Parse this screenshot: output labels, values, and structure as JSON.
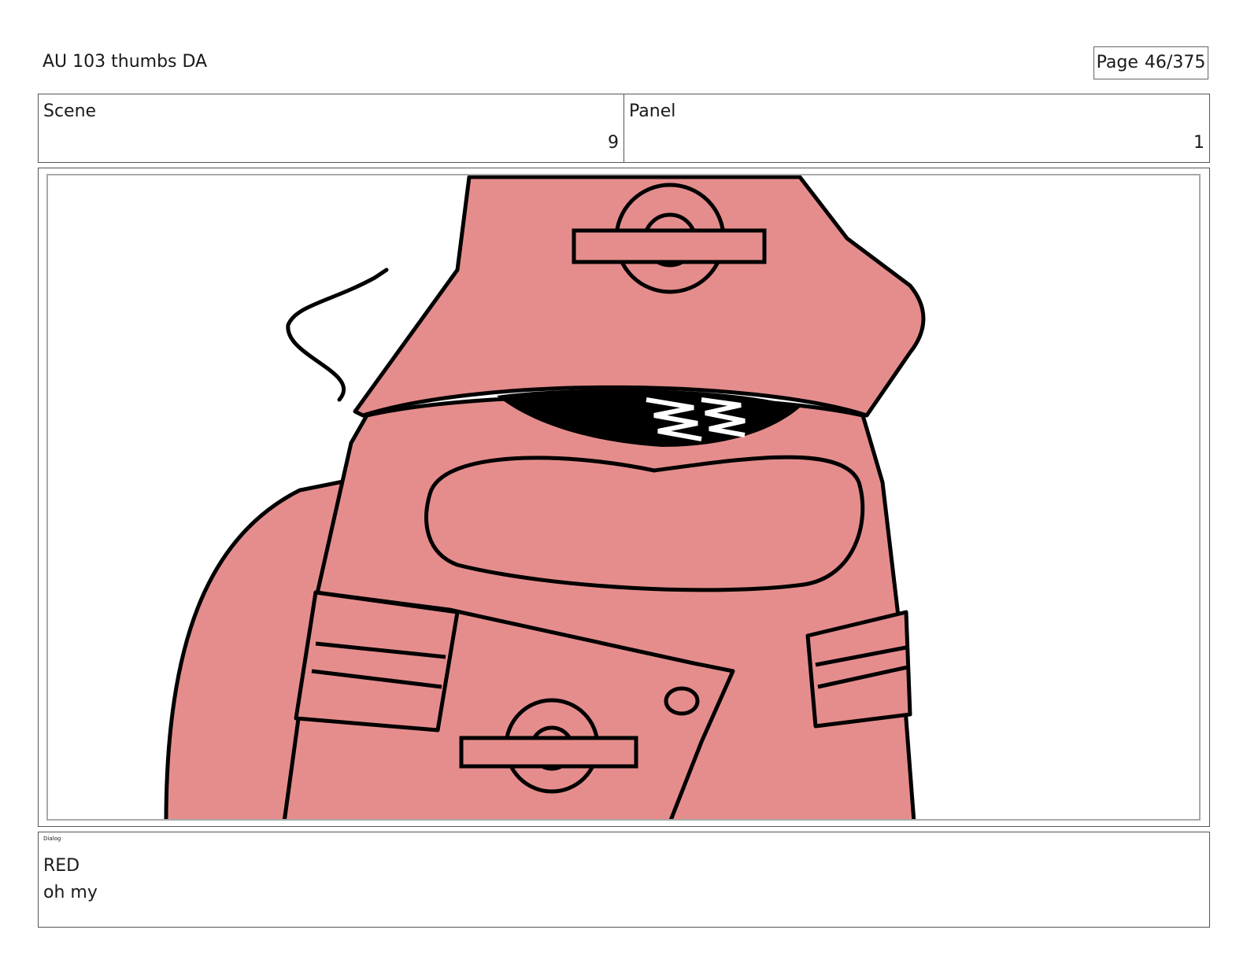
{
  "header": {
    "title": "AU 103 thumbs DA",
    "page_label": "Page",
    "page_value": "46/375"
  },
  "info": {
    "scene_label": "Scene",
    "scene_value": "9",
    "panel_label": "Panel",
    "panel_value": "1"
  },
  "panel": {
    "drawing": "red-crewmate-sketch",
    "fill_color": "#e58d8d",
    "line_color": "#000000"
  },
  "dialog": {
    "label": "Dialog",
    "character": "RED",
    "line": "oh my"
  }
}
